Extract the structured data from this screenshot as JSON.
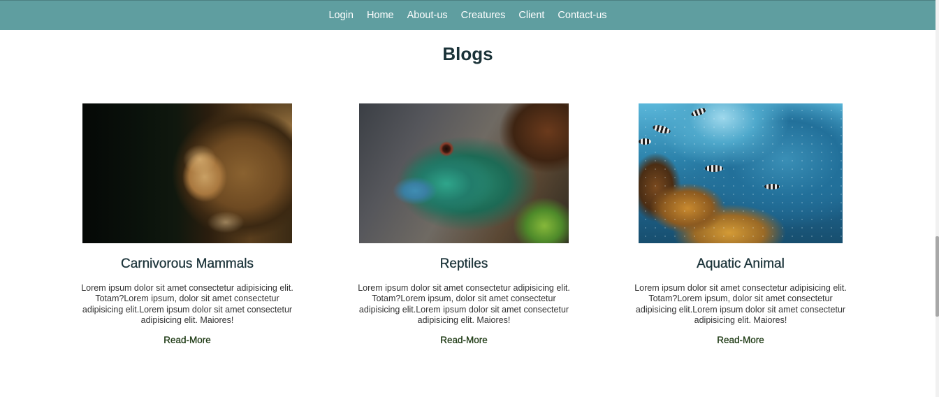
{
  "nav": {
    "items": [
      "Login",
      "Home",
      "About-us",
      "Creatures",
      "Client",
      "Contact-us"
    ]
  },
  "page": {
    "title": "Blogs"
  },
  "cards": [
    {
      "image": "lion-photo",
      "title": "Carnivorous Mammals",
      "text": "Lorem ipsum dolor sit amet consectetur adipisicing elit. Totam?Lorem ipsum, dolor sit amet consectetur adipisicing elit.Lorem ipsum dolor sit amet consectetur adipisicing elit. Maiores!",
      "link": "Read-More"
    },
    {
      "image": "iguana-photo",
      "title": "Reptiles",
      "text": "Lorem ipsum dolor sit amet consectetur adipisicing elit. Totam?Lorem ipsum, dolor sit amet consectetur adipisicing elit.Lorem ipsum dolor sit amet consectetur adipisicing elit. Maiores!",
      "link": "Read-More"
    },
    {
      "image": "coral-reef-photo",
      "title": "Aquatic Animal",
      "text": "Lorem ipsum dolor sit amet consectetur adipisicing elit. Totam?Lorem ipsum, dolor sit amet consectetur adipisicing elit.Lorem ipsum dolor sit amet consectetur adipisicing elit. Maiores!",
      "link": "Read-More"
    }
  ],
  "colors": {
    "navbar": "#5f9ea0",
    "title": "#1a3238",
    "link": "#1e3a14"
  }
}
